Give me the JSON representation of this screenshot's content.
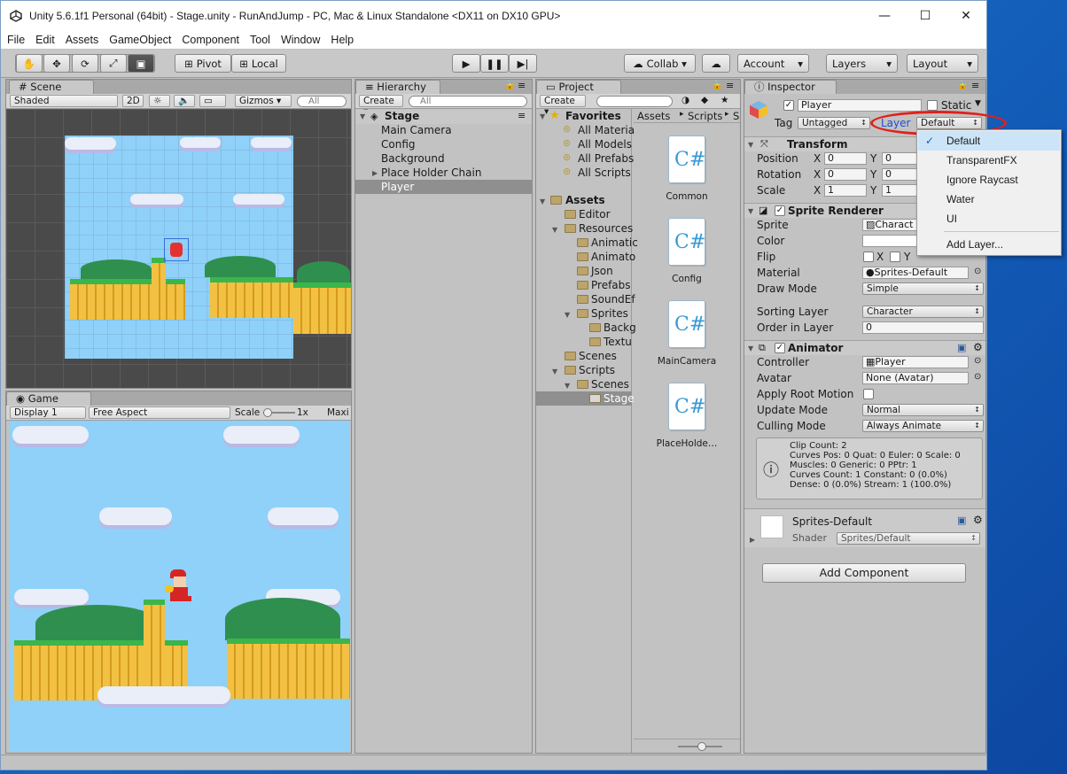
{
  "window": {
    "title": "Unity 5.6.1f1 Personal (64bit) - Stage.unity - RunAndJump - PC, Mac & Linux Standalone <DX11 on DX10 GPU>",
    "minimize": "—",
    "maximize": "☐",
    "close": "✕"
  },
  "menu": [
    "File",
    "Edit",
    "Assets",
    "GameObject",
    "Component",
    "Tool",
    "Window",
    "Help"
  ],
  "toolbar": {
    "pivot": "Pivot",
    "local": "Local",
    "collab": "Collab ▾",
    "account": "Account",
    "layers": "Layers",
    "layout": "Layout"
  },
  "scene": {
    "tab": "Scene",
    "shaded": "Shaded",
    "mode2d": "2D",
    "gizmos": "Gizmos ▾",
    "search_placeholder": "All"
  },
  "game": {
    "tab": "Game",
    "display": "Display 1",
    "aspect": "Free Aspect",
    "scale_label": "Scale",
    "scale_value": "1x",
    "maximize": "Maxi"
  },
  "hierarchy": {
    "tab": "Hierarchy",
    "create": "Create ▾",
    "search_placeholder": "All",
    "scene_name": "Stage",
    "items": [
      "Main Camera",
      "Config",
      "Background",
      "Place Holder Chain",
      "Player"
    ]
  },
  "project": {
    "tab": "Project",
    "create": "Create ▾",
    "favorites_label": "Favorites",
    "favorites": [
      "All Materia",
      "All Models",
      "All Prefabs",
      "All Scripts"
    ],
    "assets_label": "Assets",
    "tree": [
      "Editor",
      "Resources",
      "Animatic",
      "Animato",
      "Json",
      "Prefabs",
      "SoundEf",
      "Sprites",
      "Backg",
      "Textu",
      "Scenes",
      "Scripts",
      "Scenes",
      "Stage"
    ],
    "breadcrumb": [
      "Assets",
      "Scripts",
      "S"
    ],
    "files": [
      "Common",
      "Config",
      "MainCamera",
      "PlaceHolde…"
    ]
  },
  "inspector": {
    "tab": "Inspector",
    "object_name": "Player",
    "static_label": "Static",
    "tag_label": "Tag",
    "tag_value": "Untagged",
    "layer_label": "Layer",
    "layer_value": "Default",
    "transform": {
      "title": "Transform",
      "position": "Position",
      "rotation": "Rotation",
      "scale": "Scale",
      "x": "X",
      "y": "Y",
      "px": "0",
      "py": "0",
      "rx": "0",
      "ry": "0",
      "sx": "1",
      "sy": "1"
    },
    "sprite_renderer": {
      "title": "Sprite Renderer",
      "sprite": "Sprite",
      "sprite_value": "Charact",
      "color": "Color",
      "flip": "Flip",
      "flip_x": "X",
      "flip_y": "Y",
      "material": "Material",
      "material_value": "Sprites-Default",
      "draw_mode": "Draw Mode",
      "draw_mode_value": "Simple",
      "sorting_layer": "Sorting Layer",
      "sorting_layer_value": "Character",
      "order_in_layer": "Order in Layer",
      "order_value": "0"
    },
    "animator": {
      "title": "Animator",
      "controller": "Controller",
      "controller_value": "Player",
      "avatar": "Avatar",
      "avatar_value": "None (Avatar)",
      "apply_root_motion": "Apply Root Motion",
      "update_mode": "Update Mode",
      "update_mode_value": "Normal",
      "culling_mode": "Culling Mode",
      "culling_mode_value": "Always Animate",
      "info": [
        "Clip Count: 2",
        "Curves Pos: 0 Quat: 0 Euler: 0 Scale: 0",
        "Muscles: 0 Generic: 0 PPtr: 1",
        "Curves Count: 1 Constant: 0 (0.0%)",
        "Dense: 0 (0.0%) Stream: 1 (100.0%)"
      ]
    },
    "material": {
      "name": "Sprites-Default",
      "shader_label": "Shader",
      "shader_value": "Sprites/Default"
    },
    "add_component": "Add Component"
  },
  "layer_menu": {
    "items": [
      "Default",
      "TransparentFX",
      "Ignore Raycast",
      "Water",
      "UI",
      "Add Layer..."
    ],
    "selected": "Default"
  },
  "colors": {
    "highlight_circle": "#e0201c",
    "menu_selected": "#cce4f7",
    "selection": "#8f8f8f",
    "link_blue": "#1f4fd6"
  }
}
